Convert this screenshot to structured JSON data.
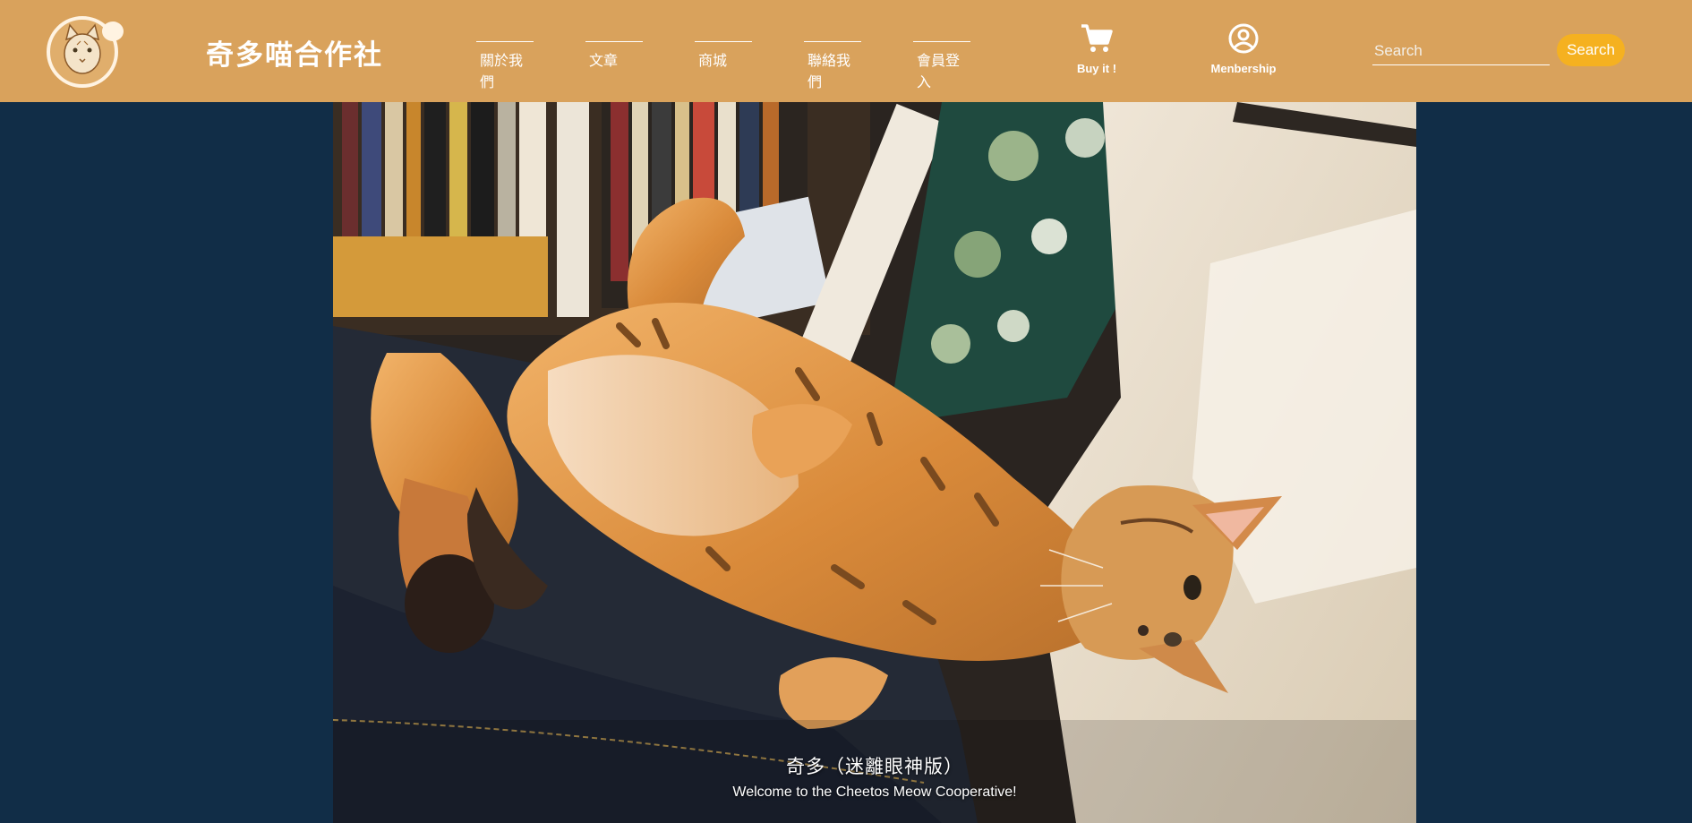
{
  "header": {
    "brand": "奇多喵合作社",
    "logo_icon": "cat-face-logo-icon"
  },
  "nav": {
    "items": [
      {
        "label": "關於我們"
      },
      {
        "label": "文章"
      },
      {
        "label": "商城"
      },
      {
        "label": "聯絡我們"
      },
      {
        "label": "會員登入"
      }
    ]
  },
  "actions": {
    "buy": {
      "label": "Buy it !",
      "icon": "shopping-cart-icon"
    },
    "membership": {
      "label": "Menbership",
      "icon": "user-circle-icon"
    }
  },
  "search": {
    "placeholder": "Search",
    "value": "",
    "button_label": "Search"
  },
  "hero": {
    "title": "奇多（迷離眼神版）",
    "subtitle": "Welcome to the Cheetos Meow Cooperative!"
  },
  "colors": {
    "navbar": "#d9a25c",
    "background": "#112d47",
    "search_button": "#f5b120",
    "text": "#ffffff"
  }
}
